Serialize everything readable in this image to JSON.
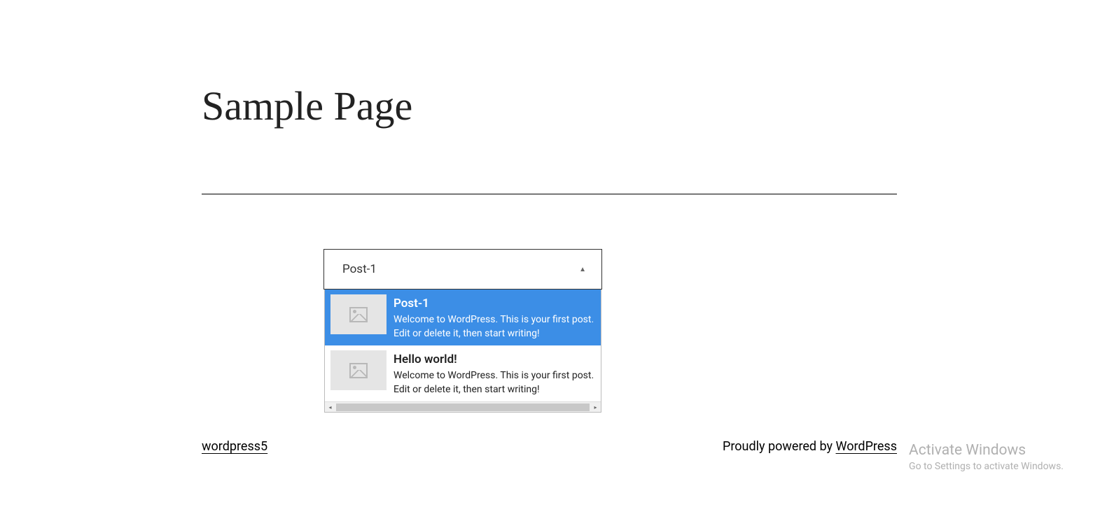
{
  "page": {
    "title": "Sample Page"
  },
  "dropdown": {
    "selected_value": "Post-1",
    "items": [
      {
        "title": "Post-1",
        "description": "Welcome to WordPress. This is your first post. Edit or delete it, then start writing!",
        "selected": true
      },
      {
        "title": "Hello world!",
        "description": "Welcome to WordPress. This is your first post. Edit or delete it, then start writing!",
        "selected": false
      }
    ]
  },
  "footer": {
    "site_link": "wordpress5",
    "powered_text": "Proudly powered by ",
    "powered_link": "WordPress"
  },
  "watermark": {
    "title": "Activate Windows",
    "subtitle": "Go to Settings to activate Windows."
  }
}
